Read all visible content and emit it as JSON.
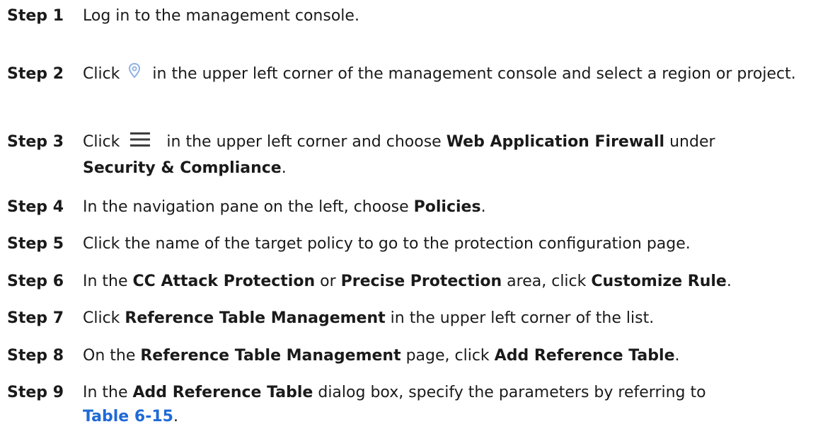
{
  "steps": [
    {
      "label": "Step 1",
      "parts": [
        "Log in to the management console."
      ]
    },
    {
      "label": "Step 2",
      "before": "Click",
      "icon": "location-pin-icon",
      "after": "in the upper left corner of the management console and select a region or project."
    },
    {
      "label": "Step 3",
      "before": "Click",
      "icon": "menu-icon",
      "t1": "in the upper left corner and choose ",
      "b1": "Web Application Firewall",
      "t2": " under ",
      "b2": "Security & Compliance",
      "t3": "."
    },
    {
      "label": "Step 4",
      "t1": "In the navigation pane on the left, choose ",
      "b1": "Policies",
      "t2": "."
    },
    {
      "label": "Step 5",
      "t1": "Click the name of the target policy to go to the protection configuration page."
    },
    {
      "label": "Step 6",
      "t1": "In the ",
      "b1": "CC Attack Protection",
      "t2": " or ",
      "b2": "Precise Protection",
      "t3": " area, click ",
      "b3": "Customize Rule",
      "t4": "."
    },
    {
      "label": "Step 7",
      "t1": "Click ",
      "b1": "Reference Table Management",
      "t2": " in the upper left corner of the list."
    },
    {
      "label": "Step 8",
      "t1": "On the ",
      "b1": "Reference Table Management",
      "t2": " page, click ",
      "b2": "Add Reference Table",
      "t3": "."
    },
    {
      "label": "Step 9",
      "t1": "In the ",
      "b1": "Add Reference Table",
      "t2": " dialog box, specify the parameters by referring to ",
      "link": "Table 6-15",
      "t3": "."
    }
  ],
  "colors": {
    "text": "#1a1a1a",
    "link": "#1f6ad6",
    "pin_icon": "#8fb0e3",
    "menu_icon": "#3c3c3c"
  }
}
